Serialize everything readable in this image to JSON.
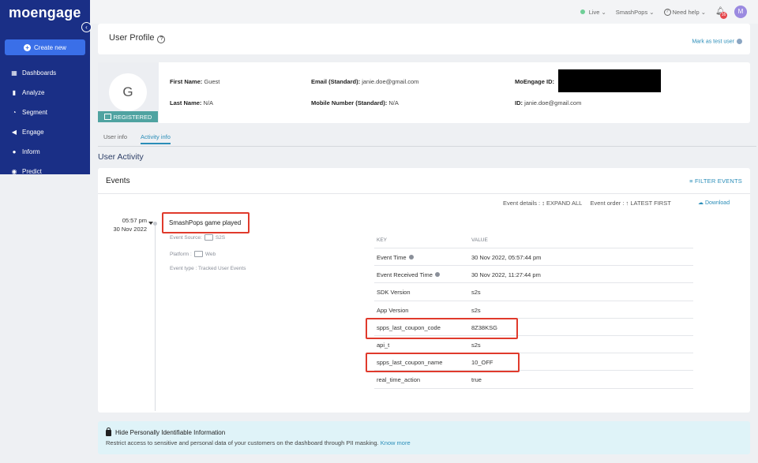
{
  "sidebar": {
    "logo": "moengage",
    "create_label": "Create new",
    "items": [
      {
        "label": "Dashboards",
        "icon": "dashboard-icon"
      },
      {
        "label": "Analyze",
        "icon": "analyze-icon"
      },
      {
        "label": "Segment",
        "icon": "segment-icon"
      },
      {
        "label": "Engage",
        "icon": "engage-icon"
      },
      {
        "label": "Inform",
        "icon": "inform-icon"
      },
      {
        "label": "Predict",
        "icon": "predict-icon"
      }
    ]
  },
  "topbar": {
    "env": "Live",
    "workspace": "SmashPops",
    "help": "Need help",
    "notifications": "16",
    "avatar": "M"
  },
  "profile": {
    "title": "User Profile",
    "mark_test": "Mark as test user",
    "avatar_letter": "G",
    "status": "REGISTERED",
    "first_name_label": "First Name:",
    "first_name": "Guest",
    "last_name_label": "Last Name:",
    "last_name": "N/A",
    "email_label": "Email (Standard):",
    "email": "janie.doe@gmail.com",
    "mobile_label": "Mobile Number (Standard):",
    "mobile": "N/A",
    "moe_id_label": "MoEngage ID:",
    "id_label": "ID:",
    "id": "janie.doe@gmail.com"
  },
  "tabs": [
    "User info",
    "Activity info"
  ],
  "section_title": "User Activity",
  "events": {
    "title": "Events",
    "filter": "FILTER EVENTS",
    "details_label": "Event details :",
    "expand": "EXPAND ALL",
    "order_label": "Event order :",
    "order": "LATEST FIRST",
    "download": "Download",
    "time": "05:57 pm",
    "date": "30 Nov 2022",
    "name": "SmashPops game played",
    "source": "Event Source:",
    "source_val": "S2S",
    "platform": "Platform :",
    "platform_val": "Web",
    "type": "Event type : Tracked User Events",
    "kv_headers": [
      "KEY",
      "VALUE"
    ],
    "rows": [
      {
        "key": "Event Time",
        "value": "30 Nov 2022, 05:57:44 pm"
      },
      {
        "key": "Event Received Time",
        "value": "30 Nov 2022, 11:27:44 pm"
      },
      {
        "key": "SDK Version",
        "value": "s2s"
      },
      {
        "key": "App Version",
        "value": "s2s"
      },
      {
        "key": "spps_last_coupon_code",
        "value": "8Z38KSG"
      },
      {
        "key": "api_t",
        "value": "s2s"
      },
      {
        "key": "spps_last_coupon_name",
        "value": "10_OFF"
      },
      {
        "key": "real_time_action",
        "value": "true"
      }
    ]
  },
  "pii": {
    "title": "Hide Personally Identifiable Information",
    "desc": "Restrict access to sensitive and personal data of your customers on the dashboard through PII masking.",
    "link": "Know more"
  }
}
